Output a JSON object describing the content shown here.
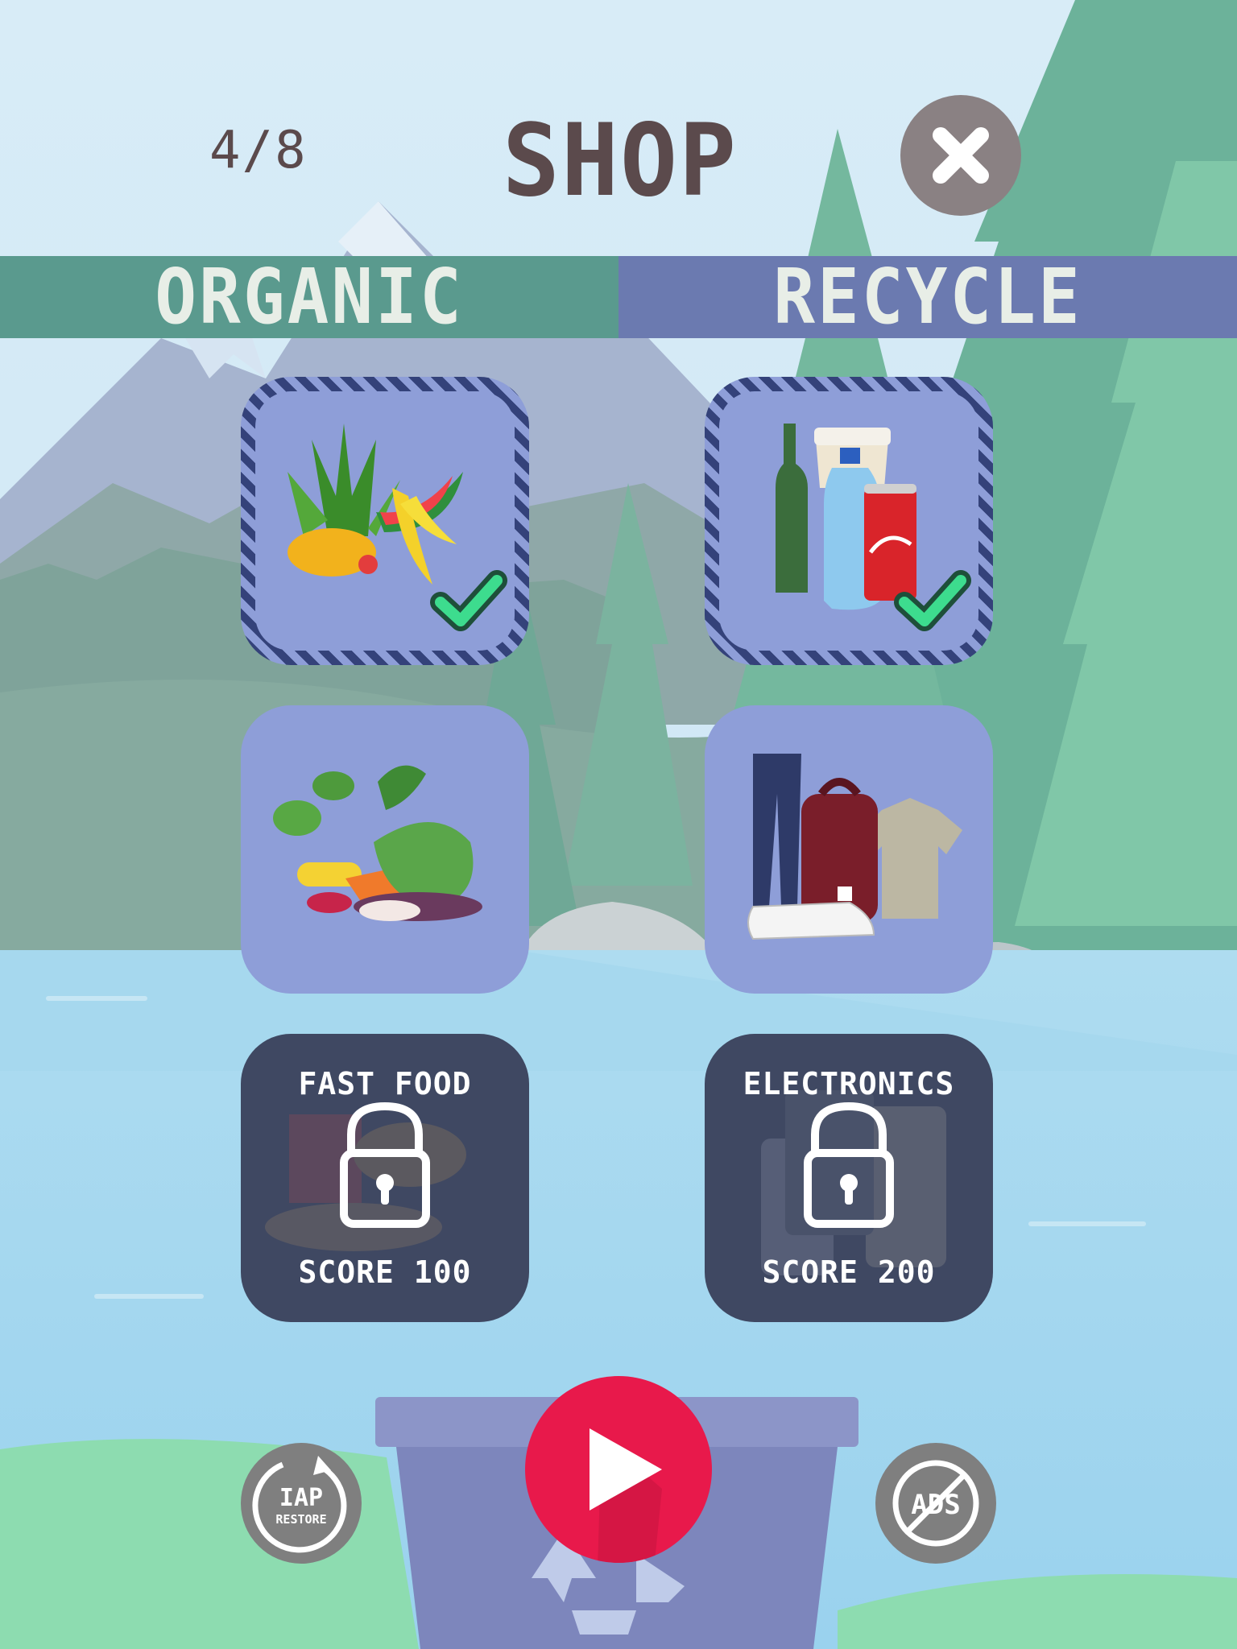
{
  "header": {
    "progress": "4/8",
    "title": "SHOP",
    "close_icon": "close-icon"
  },
  "tabs": [
    {
      "label": "ORGANIC",
      "color": "#5a9a8e"
    },
    {
      "label": "RECYCLE",
      "color": "#6b7ab0"
    }
  ],
  "items": [
    {
      "category": "organic",
      "status": "selected",
      "icon": "fruit-scraps-icon",
      "badge_icon": "check-icon"
    },
    {
      "category": "recycle",
      "status": "selected",
      "icon": "bottles-and-cans-icon",
      "badge_icon": "check-icon"
    },
    {
      "category": "organic",
      "status": "unlocked",
      "icon": "vegetable-scraps-icon"
    },
    {
      "category": "recycle",
      "status": "unlocked",
      "icon": "clothing-icon"
    },
    {
      "category": "organic",
      "status": "locked",
      "title": "FAST FOOD",
      "requirement": "SCORE 100",
      "icon": "lock-icon"
    },
    {
      "category": "recycle",
      "status": "locked",
      "title": "ELECTRONICS",
      "requirement": "SCORE 200",
      "icon": "lock-icon"
    }
  ],
  "controls": {
    "iap_restore": {
      "line1": "IAP",
      "line2": "RESTORE"
    },
    "play_icon": "play-icon",
    "no_ads": {
      "label": "ADS"
    }
  },
  "colors": {
    "accent_play": "#e8194b",
    "check": "#3ddc8e",
    "card": "#8e9ed8",
    "locked_card": "#3f4862",
    "title_text": "#5b4a4c"
  }
}
